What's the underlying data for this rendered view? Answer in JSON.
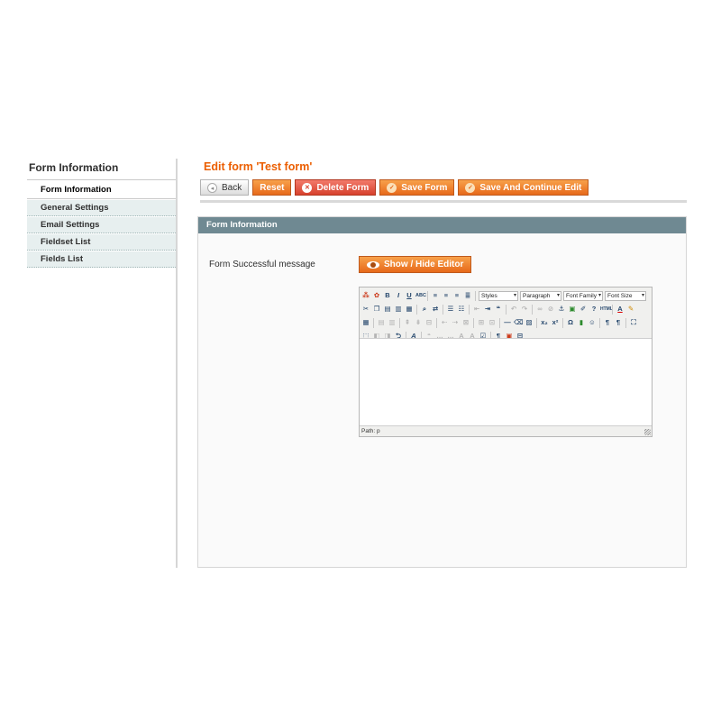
{
  "sidebar": {
    "title": "Form Information",
    "tabs": [
      {
        "label": "Form Information",
        "active": true
      },
      {
        "label": "General Settings",
        "active": false
      },
      {
        "label": "Email Settings",
        "active": false
      },
      {
        "label": "Fieldset List",
        "active": false
      },
      {
        "label": "Fields List",
        "active": false
      }
    ]
  },
  "header": {
    "title": "Edit form 'Test form'",
    "buttons": {
      "back": "Back",
      "reset": "Reset",
      "delete": "Delete Form",
      "save": "Save Form",
      "save_continue": "Save And Continue Edit"
    }
  },
  "panel": {
    "title": "Form Information",
    "field_label": "Form Successful message",
    "show_hide_label": "Show / Hide Editor"
  },
  "editor": {
    "selects": {
      "styles": "Styles",
      "paragraph": "Paragraph",
      "font_family": "Font Family",
      "font_size": "Font Size"
    },
    "content": "",
    "path": "Path: p"
  },
  "colors": {
    "accent": "#eb5e00",
    "button_orange": "#e7691a",
    "button_red": "#d7412d",
    "panel_header": "#6f8992",
    "tab_bg": "#e7efef"
  }
}
